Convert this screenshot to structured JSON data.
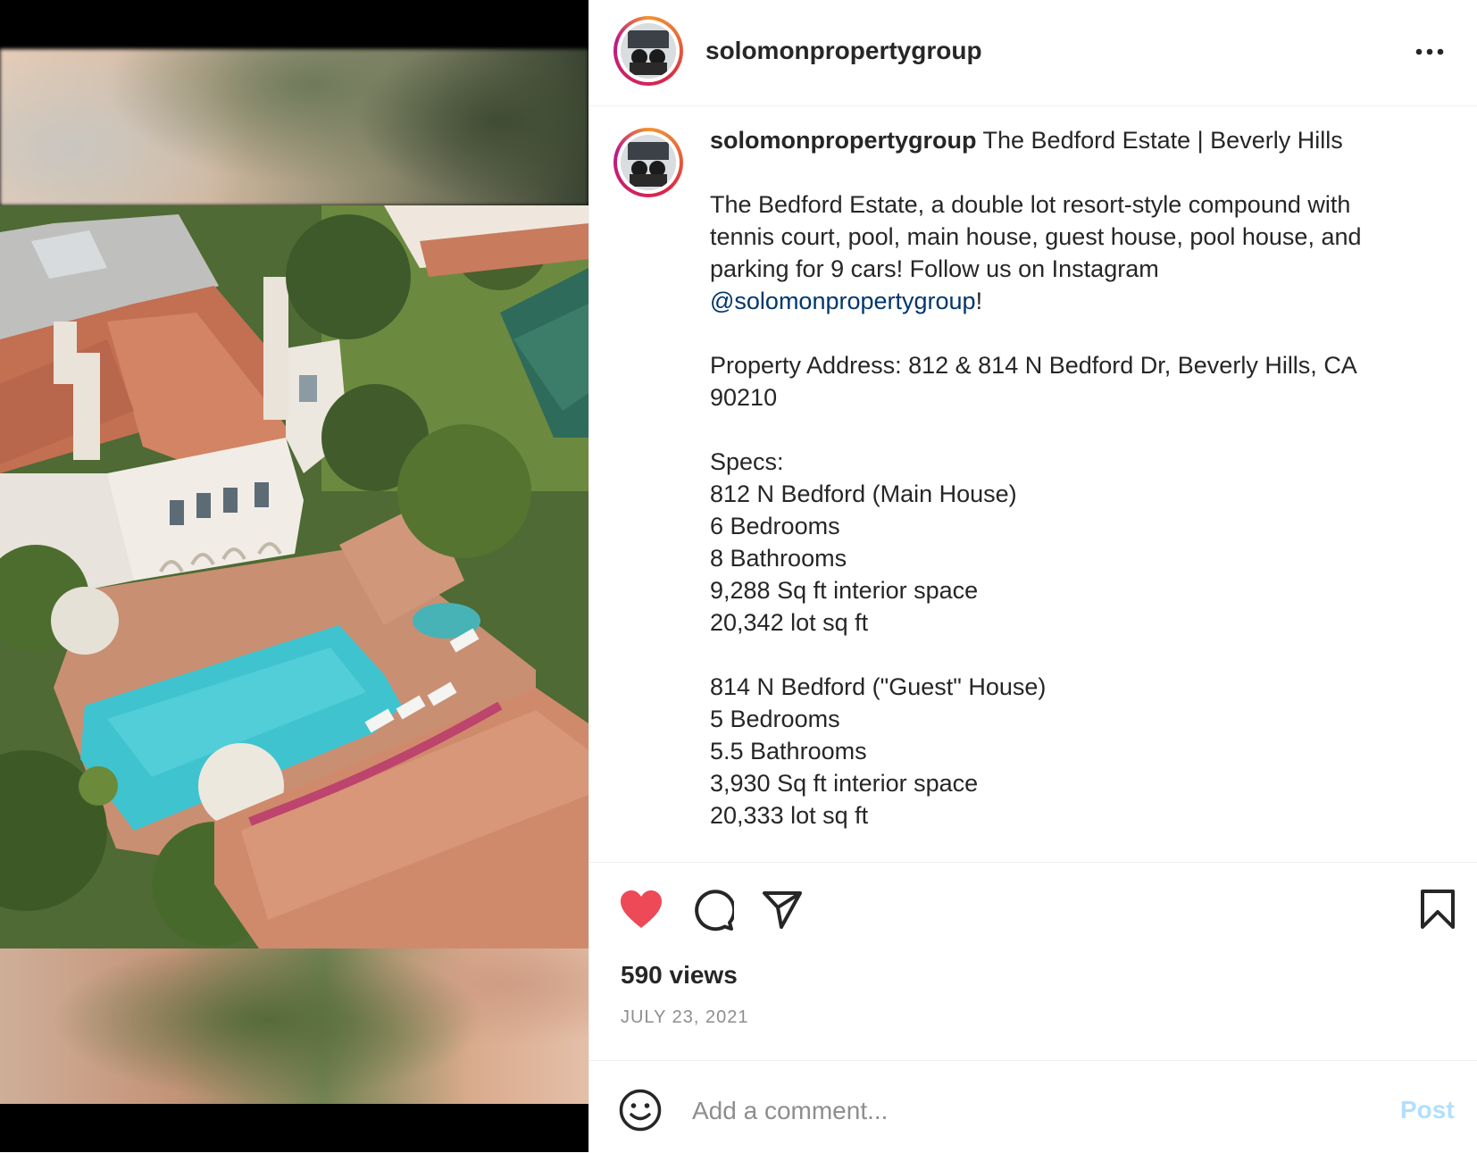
{
  "post": {
    "username": "solomonpropertygroup",
    "caption_title": "The Bedford Estate | Beverly Hills",
    "caption_lines_1": [
      "The Bedford Estate, a double lot resort-style compound with",
      "tennis court, pool, main house, guest house, pool house, and",
      "parking for 9 cars! Follow us on Instagram"
    ],
    "mention": "@solomonpropertygroup",
    "mention_suffix": "!",
    "address_lines": [
      "Property Address: 812 & 814 N Bedford Dr, Beverly Hills, CA",
      "90210"
    ],
    "specs_label": "Specs:",
    "house1": [
      "812 N Bedford (Main House)",
      "6 Bedrooms",
      "8 Bathrooms",
      "9,288 Sq ft interior space",
      "20,342 lot sq ft"
    ],
    "house2": [
      "814 N Bedford (\"Guest\" House)",
      "5 Bedrooms",
      "5.5 Bathrooms",
      "3,930 Sq ft interior space",
      "20,333 lot sq ft"
    ],
    "views": "590 views",
    "date": "JULY 23, 2021"
  },
  "comment": {
    "placeholder": "Add a comment...",
    "post_label": "Post"
  },
  "icons": {
    "like": "heart-filled-icon",
    "comment": "comment-icon",
    "share": "paper-plane-icon",
    "save": "bookmark-icon",
    "more": "more-dots-icon",
    "emoji": "emoji-smile-icon"
  },
  "colors": {
    "like": "#ed4956",
    "mention": "#00376b",
    "post_disabled": "#b2dffc",
    "muted": "#8e8e8e"
  }
}
